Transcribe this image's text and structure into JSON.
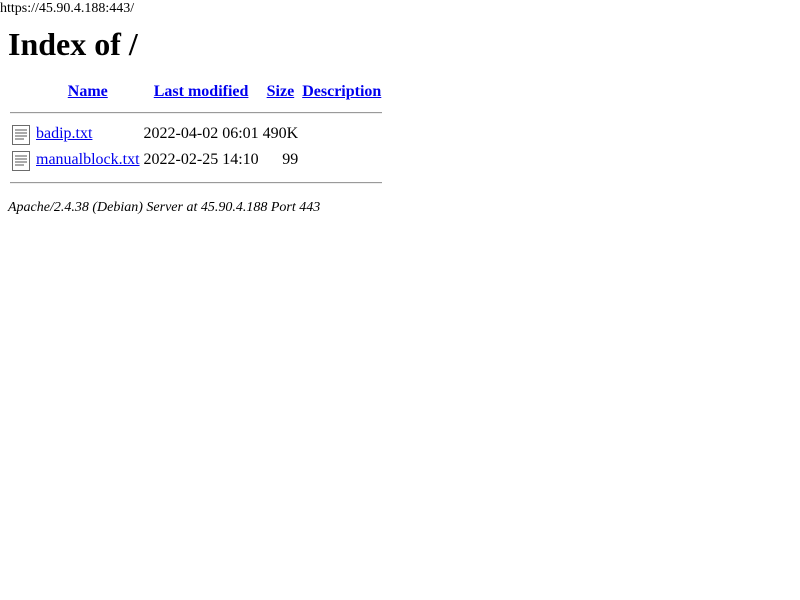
{
  "browser": {
    "url": "https://45.90.4.188:443/"
  },
  "page": {
    "title": "Index of /"
  },
  "table": {
    "headers": {
      "name": "Name",
      "last_modified": "Last modified",
      "size": "Size",
      "description": "Description"
    },
    "rows": [
      {
        "icon": "text-file-icon",
        "name": "badip.txt",
        "last_modified": "2022-04-02 06:01",
        "size": "490K",
        "description": ""
      },
      {
        "icon": "text-file-icon",
        "name": "manualblock.txt",
        "last_modified": "2022-02-25 14:10",
        "size": "99",
        "description": ""
      }
    ]
  },
  "footer": {
    "server_signature": "Apache/2.4.38 (Debian) Server at 45.90.4.188 Port 443"
  },
  "colors": {
    "link": "#0000ee",
    "text": "#000000",
    "background": "#ffffff"
  }
}
